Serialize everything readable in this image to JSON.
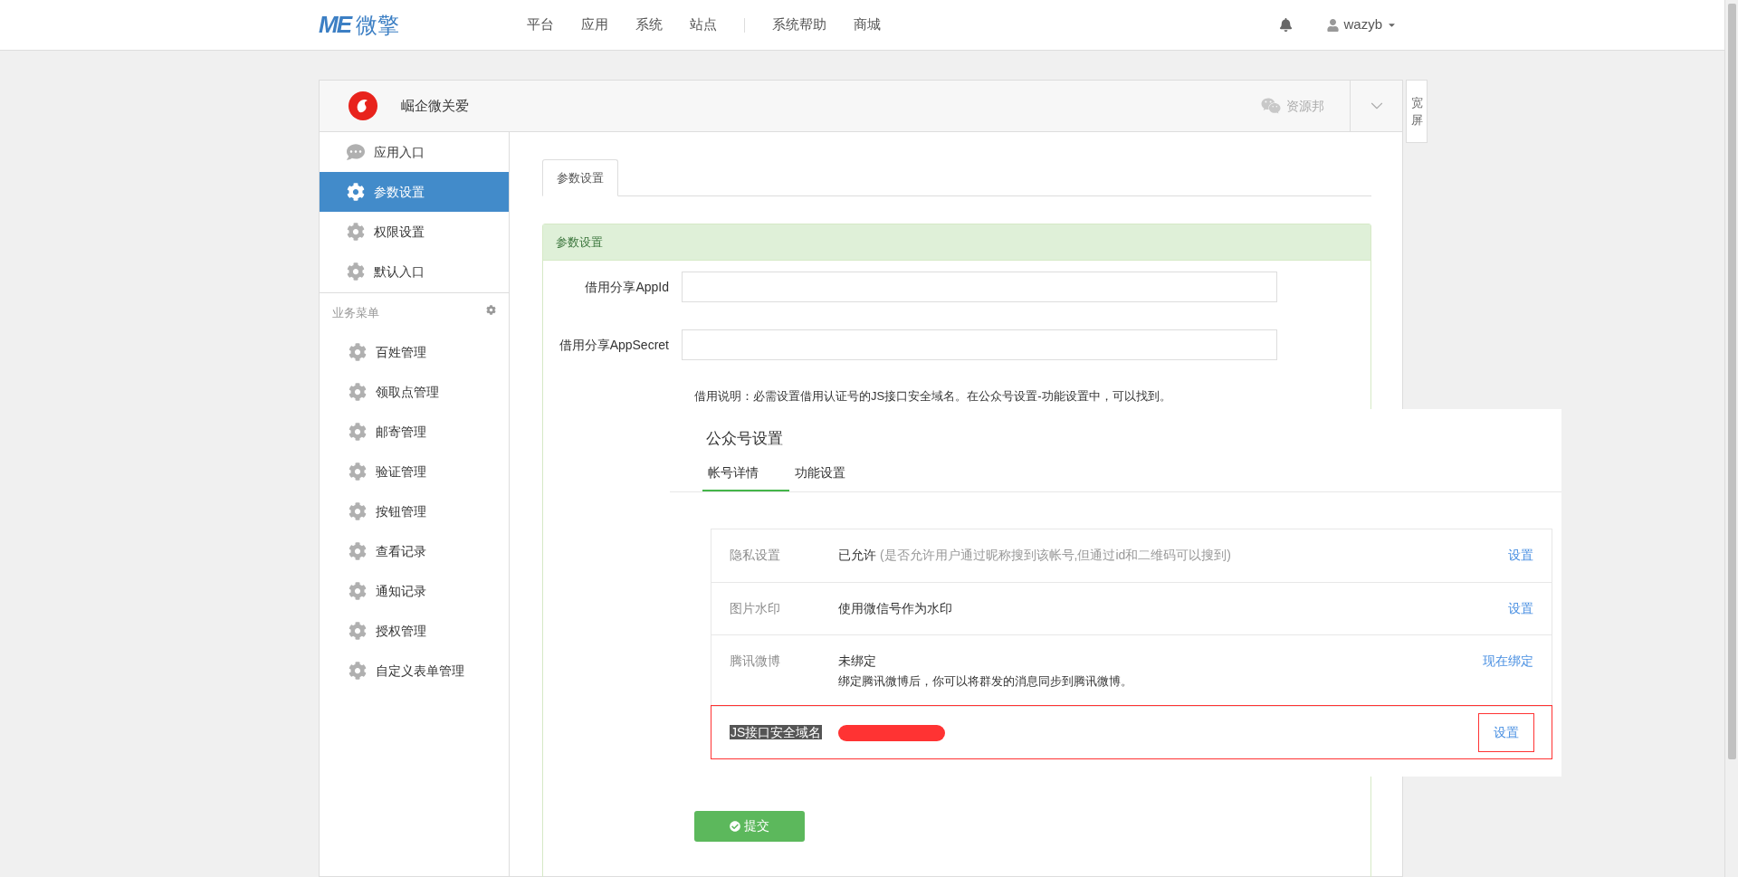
{
  "top_nav": {
    "logo_mark": "ME",
    "logo_text": "微擎",
    "items": [
      {
        "label": "平台",
        "selected": false
      },
      {
        "label": "应用",
        "selected": false
      },
      {
        "label": "系统",
        "selected": false
      },
      {
        "label": "站点",
        "selected": false
      }
    ],
    "extra_items": [
      {
        "label": "系统帮助",
        "selected": false
      },
      {
        "label": "商城",
        "selected": false
      }
    ],
    "user": "wazyb"
  },
  "app_header": {
    "name": "崛企微关爱",
    "account": "资源邦",
    "wide_toggle": "宽屏"
  },
  "sidebar": {
    "items": [
      {
        "label": "应用入口",
        "kind": "chat",
        "selected": false
      },
      {
        "label": "参数设置",
        "kind": "gear",
        "selected": true
      },
      {
        "label": "权限设置",
        "kind": "gear",
        "selected": false
      },
      {
        "label": "默认入口",
        "kind": "gear",
        "selected": false
      }
    ],
    "section": {
      "title": "业务菜单",
      "items": [
        {
          "label": "百姓管理",
          "selected": false
        },
        {
          "label": "领取点管理",
          "selected": false
        },
        {
          "label": "邮寄管理",
          "selected": false
        },
        {
          "label": "验证管理",
          "selected": false
        },
        {
          "label": "按钮管理",
          "selected": false
        },
        {
          "label": "查看记录",
          "selected": false
        },
        {
          "label": "通知记录",
          "selected": false
        },
        {
          "label": "授权管理",
          "selected": false
        },
        {
          "label": "自定义表单管理",
          "selected": false
        }
      ]
    }
  },
  "tabs": [
    {
      "label": "参数设置",
      "selected": true
    }
  ],
  "form": {
    "title": "参数设置",
    "fields": [
      {
        "label": "借用分享AppId"
      },
      {
        "label": "借用分享AppSecret"
      }
    ],
    "help_text": "借用说明：必需设置借用认证号的JS接口安全域名。在公众号设置-功能设置中，可以找到。",
    "embedded_screenshot": {
      "title": "公众号设置",
      "tabs": [
        {
          "label": "帐号详情",
          "selected": true
        },
        {
          "label": "功能设置",
          "selected": false
        }
      ],
      "rows": [
        {
          "kind": "text",
          "label": "隐私设置",
          "value": "已允许",
          "note": "(是否允许用户通过昵称搜到该帐号,但通过id和二维码可以搜到)",
          "action": "设置",
          "highlighted": false
        },
        {
          "kind": "text",
          "label": "图片水印",
          "value": "使用微信号作为水印",
          "action": "设置",
          "highlighted": false
        },
        {
          "kind": "two_line",
          "label": "腾讯微博",
          "value": "未绑定",
          "note": "绑定腾讯微博后，你可以将群发的消息同步到腾讯微博。",
          "action": "现在绑定",
          "highlighted": false
        },
        {
          "kind": "redacted",
          "label": "JS接口安全域名",
          "action": "设置",
          "highlighted": true
        }
      ]
    },
    "submit": "提交"
  }
}
